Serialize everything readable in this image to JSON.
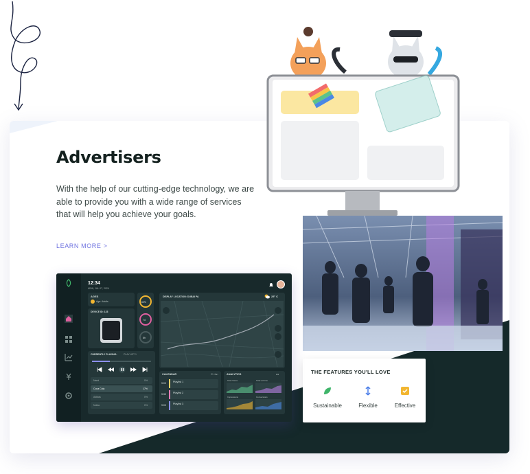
{
  "colors": {
    "accent": "#6f73e0",
    "dark": "#18292b",
    "title": "#14211f"
  },
  "hero": {
    "title": "Advertisers",
    "description": "With the help of our cutting-edge technology, we are able to provide you with a wide range of services that will help you achieve your goals.",
    "learn_more": "LEARN MORE >"
  },
  "features": {
    "title": "THE FEATURES YOU'LL LOVE",
    "items": [
      {
        "label": "Sustainable",
        "icon": "leaf-icon"
      },
      {
        "label": "Flexible",
        "icon": "vertical-arrows-icon"
      },
      {
        "label": "Effective",
        "icon": "check-box-icon"
      }
    ]
  },
  "dashboard": {
    "time": "12:34",
    "date": "MON, JUL 07, 2024",
    "ages_label": "AGES",
    "age_value": "Age: Adults",
    "device_label": "DEVICE ID: 123",
    "stat1": "60%",
    "stat2": "7d",
    "stat3": "8h",
    "map_label": "DISPLAY LOCATION: DUBAI PA",
    "weather": "25° C",
    "now_playing_label": "CURRENTLY PLAYING:",
    "now_playing_value": "PLAYLIST 1",
    "track_items": [
      {
        "name": "Nami",
        "pct": "0%"
      },
      {
        "name": "Coca Cola",
        "pct": "17%"
      },
      {
        "name": "Adidas",
        "pct": "0%"
      },
      {
        "name": "Nokia",
        "pct": "0%"
      }
    ],
    "calendar_label": "CALENDAR",
    "calendar_date": "21 Jan",
    "playlists": [
      {
        "time": "9:00",
        "name": "Playlist 1",
        "color": "#f5d36a"
      },
      {
        "time": "9:30",
        "name": "Playlist 2",
        "color": "#e67fb8"
      },
      {
        "time": "9:00",
        "name": "Playlist 3",
        "color": "#8d8ff0"
      }
    ],
    "analytics_label": "ANALYTICS",
    "analytics_more": "•••",
    "analytics": [
      "Total Views",
      "Total ad time",
      "Impressions",
      "Conversions"
    ]
  }
}
